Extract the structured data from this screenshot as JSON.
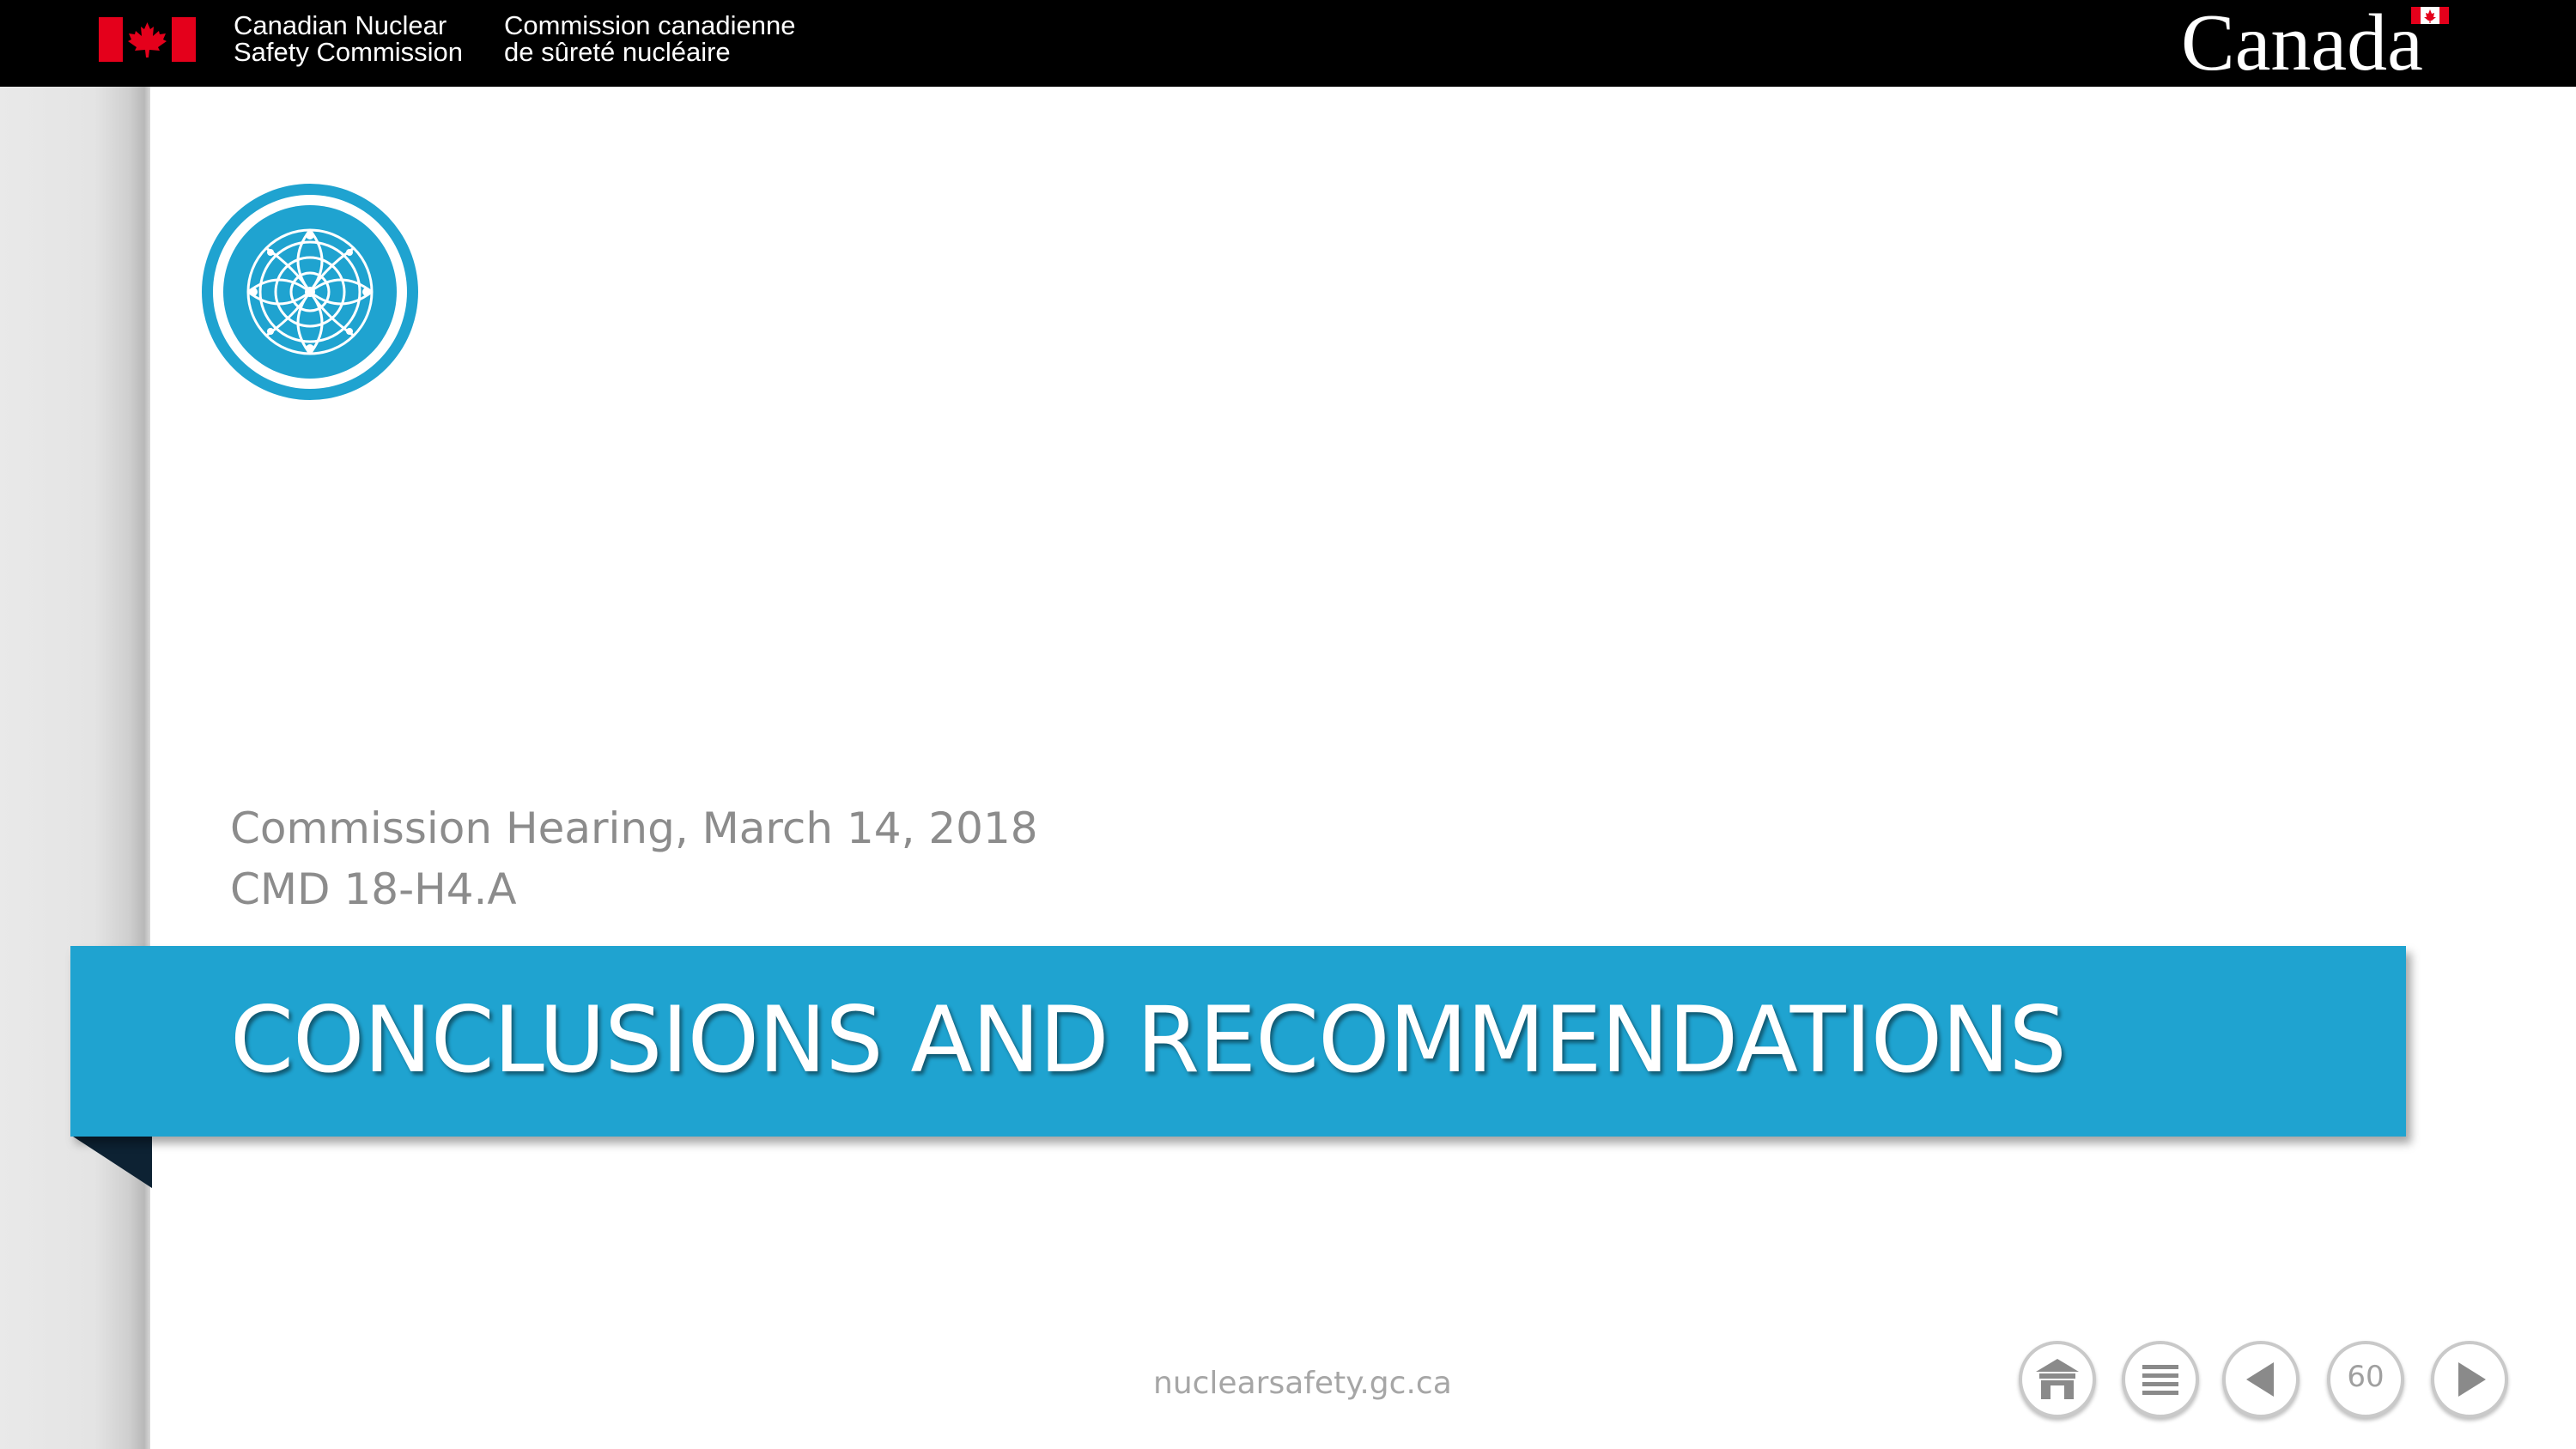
{
  "header": {
    "org_name_en_line1": "Canadian Nuclear",
    "org_name_en_line2": "Safety Commission",
    "org_name_fr_line1": "Commission canadienne",
    "org_name_fr_line2": "de sûreté nucléaire",
    "wordmark": "Canada",
    "flag_icon": "canada-flag-icon",
    "background_color": "#000000"
  },
  "slide": {
    "logo_icon": "commission-seal-icon",
    "hearing_line": "Commission Hearing, March 14, 2018",
    "cmd_line": "CMD 18-H4.A",
    "title": "CONCLUSIONS AND RECOMMENDATIONS",
    "accent_color": "#1fa3d0",
    "subtitle_color": "#8c8c8c"
  },
  "footer": {
    "url": "nuclearsafety.gc.ca",
    "nav": {
      "home_icon": "home-icon",
      "menu_icon": "menu-icon",
      "prev_icon": "previous-arrow-icon",
      "page_number": "60",
      "next_icon": "next-arrow-icon"
    }
  }
}
